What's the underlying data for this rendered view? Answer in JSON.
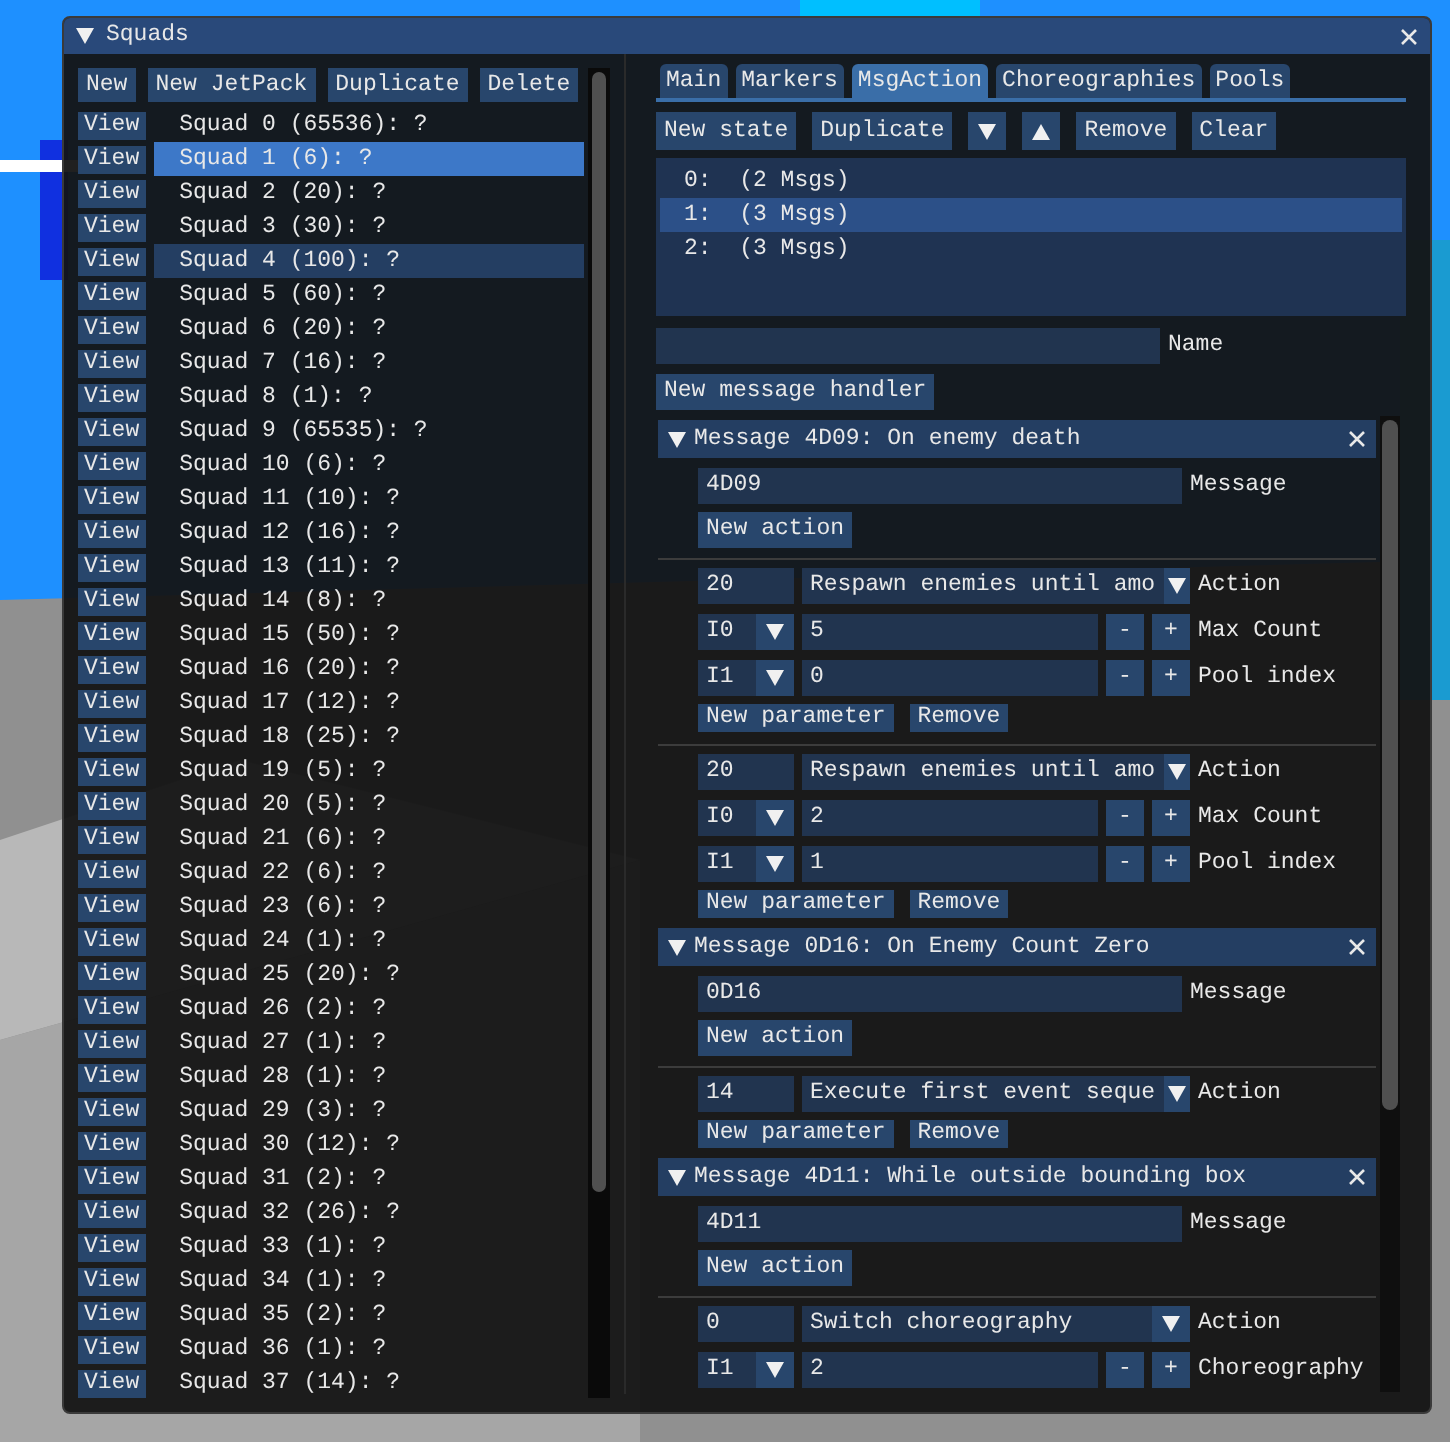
{
  "window": {
    "title": "Squads",
    "expanded": true
  },
  "left_toolbar": [
    "New",
    "New JetPack",
    "Duplicate",
    "Delete"
  ],
  "squads": [
    {
      "view": "View",
      "label": "Squad 0 (65536): ?",
      "selected": false,
      "hovered": false
    },
    {
      "view": "View",
      "label": "Squad 1 (6): ?",
      "selected": false,
      "hovered": true
    },
    {
      "view": "View",
      "label": "Squad 2 (20): ?",
      "selected": false,
      "hovered": false
    },
    {
      "view": "View",
      "label": "Squad 3 (30): ?",
      "selected": false,
      "hovered": false
    },
    {
      "view": "View",
      "label": "Squad 4 (100): ?",
      "selected": true,
      "hovered": false
    },
    {
      "view": "View",
      "label": "Squad 5 (60): ?",
      "selected": false,
      "hovered": false
    },
    {
      "view": "View",
      "label": "Squad 6 (20): ?",
      "selected": false,
      "hovered": false
    },
    {
      "view": "View",
      "label": "Squad 7 (16): ?",
      "selected": false,
      "hovered": false
    },
    {
      "view": "View",
      "label": "Squad 8 (1): ?",
      "selected": false,
      "hovered": false
    },
    {
      "view": "View",
      "label": "Squad 9 (65535): ?",
      "selected": false,
      "hovered": false
    },
    {
      "view": "View",
      "label": "Squad 10 (6): ?",
      "selected": false,
      "hovered": false
    },
    {
      "view": "View",
      "label": "Squad 11 (10): ?",
      "selected": false,
      "hovered": false
    },
    {
      "view": "View",
      "label": "Squad 12 (16): ?",
      "selected": false,
      "hovered": false
    },
    {
      "view": "View",
      "label": "Squad 13 (11): ?",
      "selected": false,
      "hovered": false
    },
    {
      "view": "View",
      "label": "Squad 14 (8): ?",
      "selected": false,
      "hovered": false
    },
    {
      "view": "View",
      "label": "Squad 15 (50): ?",
      "selected": false,
      "hovered": false
    },
    {
      "view": "View",
      "label": "Squad 16 (20): ?",
      "selected": false,
      "hovered": false
    },
    {
      "view": "View",
      "label": "Squad 17 (12): ?",
      "selected": false,
      "hovered": false
    },
    {
      "view": "View",
      "label": "Squad 18 (25): ?",
      "selected": false,
      "hovered": false
    },
    {
      "view": "View",
      "label": "Squad 19 (5): ?",
      "selected": false,
      "hovered": false
    },
    {
      "view": "View",
      "label": "Squad 20 (5): ?",
      "selected": false,
      "hovered": false
    },
    {
      "view": "View",
      "label": "Squad 21 (6): ?",
      "selected": false,
      "hovered": false
    },
    {
      "view": "View",
      "label": "Squad 22 (6): ?",
      "selected": false,
      "hovered": false
    },
    {
      "view": "View",
      "label": "Squad 23 (6): ?",
      "selected": false,
      "hovered": false
    },
    {
      "view": "View",
      "label": "Squad 24 (1): ?",
      "selected": false,
      "hovered": false
    },
    {
      "view": "View",
      "label": "Squad 25 (20): ?",
      "selected": false,
      "hovered": false
    },
    {
      "view": "View",
      "label": "Squad 26 (2): ?",
      "selected": false,
      "hovered": false
    },
    {
      "view": "View",
      "label": "Squad 27 (1): ?",
      "selected": false,
      "hovered": false
    },
    {
      "view": "View",
      "label": "Squad 28 (1): ?",
      "selected": false,
      "hovered": false
    },
    {
      "view": "View",
      "label": "Squad 29 (3): ?",
      "selected": false,
      "hovered": false
    },
    {
      "view": "View",
      "label": "Squad 30 (12): ?",
      "selected": false,
      "hovered": false
    },
    {
      "view": "View",
      "label": "Squad 31 (2): ?",
      "selected": false,
      "hovered": false
    },
    {
      "view": "View",
      "label": "Squad 32 (26): ?",
      "selected": false,
      "hovered": false
    },
    {
      "view": "View",
      "label": "Squad 33 (1): ?",
      "selected": false,
      "hovered": false
    },
    {
      "view": "View",
      "label": "Squad 34 (1): ?",
      "selected": false,
      "hovered": false
    },
    {
      "view": "View",
      "label": "Squad 35 (2): ?",
      "selected": false,
      "hovered": false
    },
    {
      "view": "View",
      "label": "Squad 36 (1): ?",
      "selected": false,
      "hovered": false
    },
    {
      "view": "View",
      "label": "Squad 37 (14): ?",
      "selected": false,
      "hovered": false
    }
  ],
  "tabs": [
    {
      "label": "Main",
      "selected": false
    },
    {
      "label": "Markers",
      "selected": false
    },
    {
      "label": "MsgAction",
      "selected": true
    },
    {
      "label": "Choreographies",
      "selected": false
    },
    {
      "label": "Pools",
      "selected": false
    }
  ],
  "state_toolbar": [
    {
      "kind": "text",
      "label": "New state"
    },
    {
      "kind": "text",
      "label": "Duplicate"
    },
    {
      "kind": "down"
    },
    {
      "kind": "up"
    },
    {
      "kind": "text",
      "label": "Remove"
    },
    {
      "kind": "text",
      "label": "Clear"
    }
  ],
  "states": [
    {
      "label": "0:  (2 Msgs)",
      "selected": false
    },
    {
      "label": "1:  (3 Msgs)",
      "selected": true
    },
    {
      "label": "2:  (3 Msgs)",
      "selected": false
    }
  ],
  "name_field": {
    "label": "Name"
  },
  "new_handler_button": "New message handler",
  "handlers": [
    {
      "title": "Message 4D09: On enemy death",
      "expanded": true,
      "message_value": "4D09",
      "message_label": "Message",
      "new_action": "New action",
      "actions": [
        {
          "id": "20",
          "action": "Respawn enemies until amo",
          "action_label": "Action",
          "params": [
            {
              "type": "I0",
              "value": "5",
              "dec": "-",
              "inc": "+",
              "label": "Max Count"
            },
            {
              "type": "I1",
              "value": "0",
              "dec": "-",
              "inc": "+",
              "label": "Pool index"
            }
          ],
          "new_parameter": "New parameter",
          "remove": "Remove"
        },
        {
          "id": "20",
          "action": "Respawn enemies until amo",
          "action_label": "Action",
          "params": [
            {
              "type": "I0",
              "value": "2",
              "dec": "-",
              "inc": "+",
              "label": "Max Count"
            },
            {
              "type": "I1",
              "value": "1",
              "dec": "-",
              "inc": "+",
              "label": "Pool index"
            }
          ],
          "new_parameter": "New parameter",
          "remove": "Remove"
        }
      ]
    },
    {
      "title": "Message 0D16: On Enemy Count Zero",
      "expanded": true,
      "message_value": "0D16",
      "message_label": "Message",
      "new_action": "New action",
      "actions": [
        {
          "id": "14",
          "action": "Execute first event seque",
          "action_label": "Action",
          "new_parameter": "New parameter",
          "remove": "Remove"
        }
      ]
    },
    {
      "title": "Message 4D11: While outside bounding box",
      "expanded": true,
      "message_value": "4D11",
      "message_label": "Message",
      "new_action": "New action",
      "actions": [
        {
          "id": "0",
          "action": "Switch choreography",
          "action_label": "Action",
          "params": [
            {
              "type": "I1",
              "value": "2",
              "dec": "-",
              "inc": "+",
              "label": "Choreography"
            }
          ]
        }
      ]
    }
  ]
}
